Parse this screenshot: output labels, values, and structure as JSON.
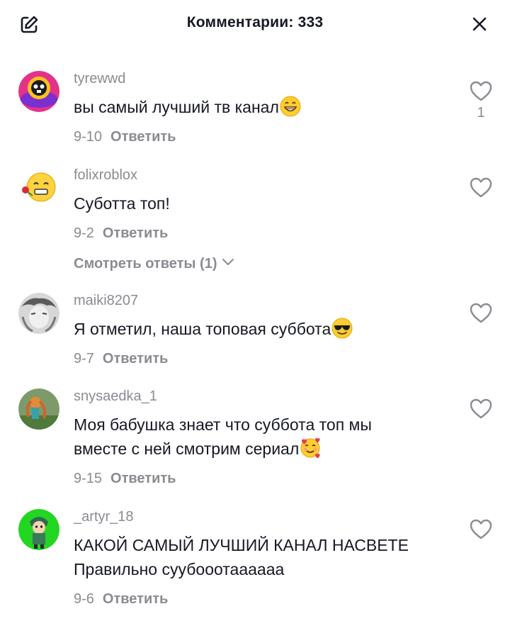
{
  "header": {
    "title": "Комментарии: 333",
    "edit_icon": "edit-icon",
    "close_icon": "close-icon"
  },
  "comments": [
    {
      "username": "tyrewwd",
      "text": "вы самый лучший тв канал",
      "emoji": "grinning-face",
      "date": "9-10",
      "reply_label": "Ответить",
      "likes": "1"
    },
    {
      "username": "folixroblox",
      "text": "Суботта топ!",
      "date": "9-2",
      "reply_label": "Ответить",
      "view_replies": "Смотреть ответы (1)"
    },
    {
      "username": "maiki8207",
      "text": "Я отметил, наша топовая суббота",
      "emoji": "sunglasses-face",
      "date": "9-7",
      "reply_label": "Ответить"
    },
    {
      "username": "snysaedka_1",
      "text_line1": "Моя бабушка знает что суббота топ мы",
      "text_line2": "вместе с ней смотрим сериал",
      "emoji": "smiling-face-with-hearts",
      "date": "9-15",
      "reply_label": "Ответить"
    },
    {
      "username": "_artyr_18",
      "text_line1": "КАКОЙ САМЫЙ ЛУЧШИЙ КАНАЛ НАСВЕТЕ",
      "text_line2": "Правильно суубооотаааааа",
      "date": "9-6",
      "reply_label": "Ответить"
    }
  ],
  "colors": {
    "primary_text": "#161823",
    "secondary_text": "#8a8b91",
    "background": "#ffffff"
  }
}
